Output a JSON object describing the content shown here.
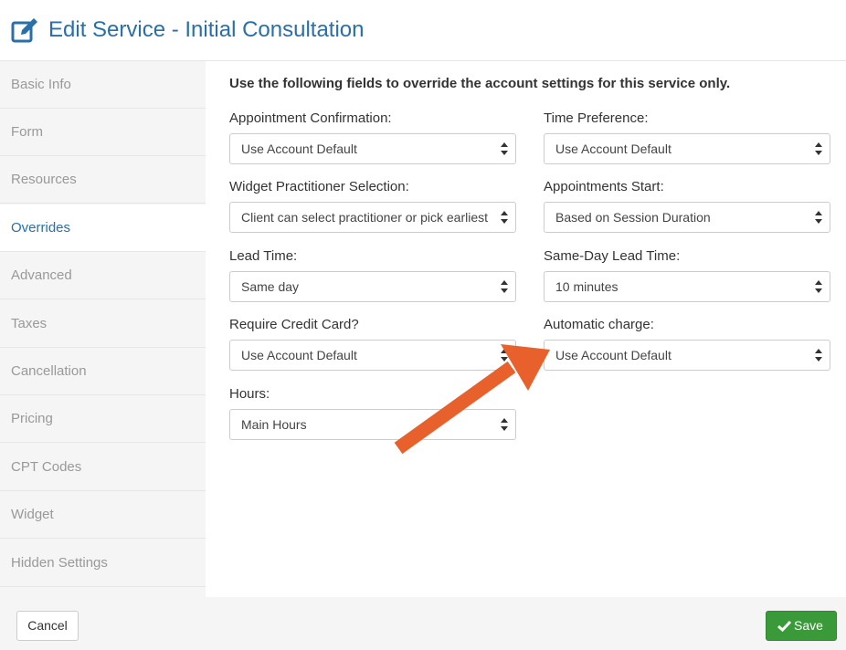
{
  "header": {
    "title": "Edit Service - Initial Consultation",
    "icon": "edit-icon"
  },
  "sidebar": {
    "items": [
      {
        "label": "Basic Info"
      },
      {
        "label": "Form"
      },
      {
        "label": "Resources"
      },
      {
        "label": "Overrides",
        "active": true
      },
      {
        "label": "Advanced"
      },
      {
        "label": "Taxes"
      },
      {
        "label": "Cancellation"
      },
      {
        "label": "Pricing"
      },
      {
        "label": "CPT Codes"
      },
      {
        "label": "Widget"
      },
      {
        "label": "Hidden Settings"
      }
    ]
  },
  "main": {
    "intro": "Use the following fields to override the account settings for this service only.",
    "fields": {
      "appointment_confirmation": {
        "label": "Appointment Confirmation:",
        "value": "Use Account Default"
      },
      "time_preference": {
        "label": "Time Preference:",
        "value": "Use Account Default"
      },
      "widget_practitioner_selection": {
        "label": "Widget Practitioner Selection:",
        "value": "Client can select practitioner or pick earliest"
      },
      "appointments_start": {
        "label": "Appointments Start:",
        "value": "Based on Session Duration"
      },
      "lead_time": {
        "label": "Lead Time:",
        "value": "Same day"
      },
      "same_day_lead_time": {
        "label": "Same-Day Lead Time:",
        "value": "10 minutes"
      },
      "require_credit_card": {
        "label": "Require Credit Card?",
        "value": "Use Account Default"
      },
      "automatic_charge": {
        "label": "Automatic charge:",
        "value": "Use Account Default"
      },
      "hours": {
        "label": "Hours:",
        "value": "Main Hours"
      }
    }
  },
  "footer": {
    "cancel_label": "Cancel",
    "save_label": "Save"
  },
  "colors": {
    "accent": "#2a6fa8",
    "save_green": "#3a9a3a",
    "annotation_arrow": "#e8612c"
  },
  "annotation": {
    "icon": "annotation-arrow-icon"
  }
}
